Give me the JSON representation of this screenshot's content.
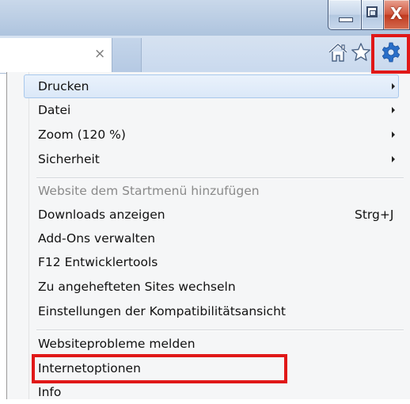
{
  "window": {
    "minimize_glyph": "minimize",
    "maximize_glyph": "maximize",
    "close_glyph": "X"
  },
  "tab": {
    "close_glyph": "×"
  },
  "toolbar": {
    "icons": [
      "home-icon",
      "favorites-star-icon",
      "tools-gear-icon"
    ],
    "highlight_color": "#e01818"
  },
  "menu": {
    "items": [
      {
        "label": "Drucken",
        "submenu": true,
        "state": "hover"
      },
      {
        "label": "Datei",
        "submenu": true
      },
      {
        "label": "Zoom (120 %)",
        "submenu": true
      },
      {
        "label": "Sicherheit",
        "submenu": true
      },
      {
        "label": "Website dem Startmenü hinzufügen",
        "disabled": true
      },
      {
        "label": "Downloads anzeigen",
        "shortcut": "Strg+J"
      },
      {
        "label": "Add-Ons verwalten"
      },
      {
        "label": "F12 Entwicklertools"
      },
      {
        "label": "Zu angehefteten Sites wechseln"
      },
      {
        "label": "Einstellungen der Kompatibilitätsansicht"
      },
      {
        "label": "Websiteprobleme melden"
      },
      {
        "label": "Internetoptionen",
        "highlighted": true
      },
      {
        "label": "Info"
      }
    ]
  }
}
